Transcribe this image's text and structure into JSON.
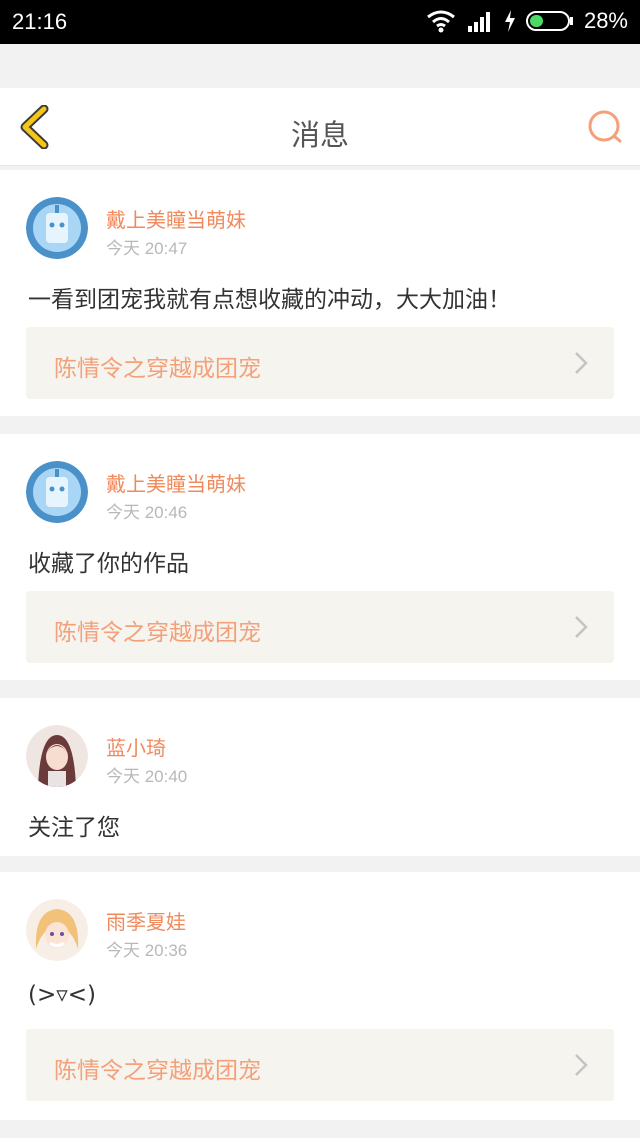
{
  "status_bar": {
    "time": "21:16",
    "battery": "28%"
  },
  "header": {
    "title": "消息"
  },
  "messages": [
    {
      "user": "戴上美瞳当萌妹",
      "time": "今天 20:47",
      "text": "一看到团宠我就有点想收藏的冲动，大大加油！",
      "book": "陈情令之穿越成团宠"
    },
    {
      "user": "戴上美瞳当萌妹",
      "time": "今天 20:46",
      "text": "收藏了你的作品",
      "book": "陈情令之穿越成团宠"
    },
    {
      "user": "蓝小琦",
      "time": "今天 20:40",
      "text": "关注了您"
    },
    {
      "user": "雨季夏娃",
      "time": "今天 20:36",
      "text": "(>▿<)",
      "book": "陈情令之穿越成团宠"
    }
  ],
  "colors": {
    "accent": "#f08a5d",
    "link_bg": "#f5f4ee",
    "back_icon": "#f5c518"
  }
}
